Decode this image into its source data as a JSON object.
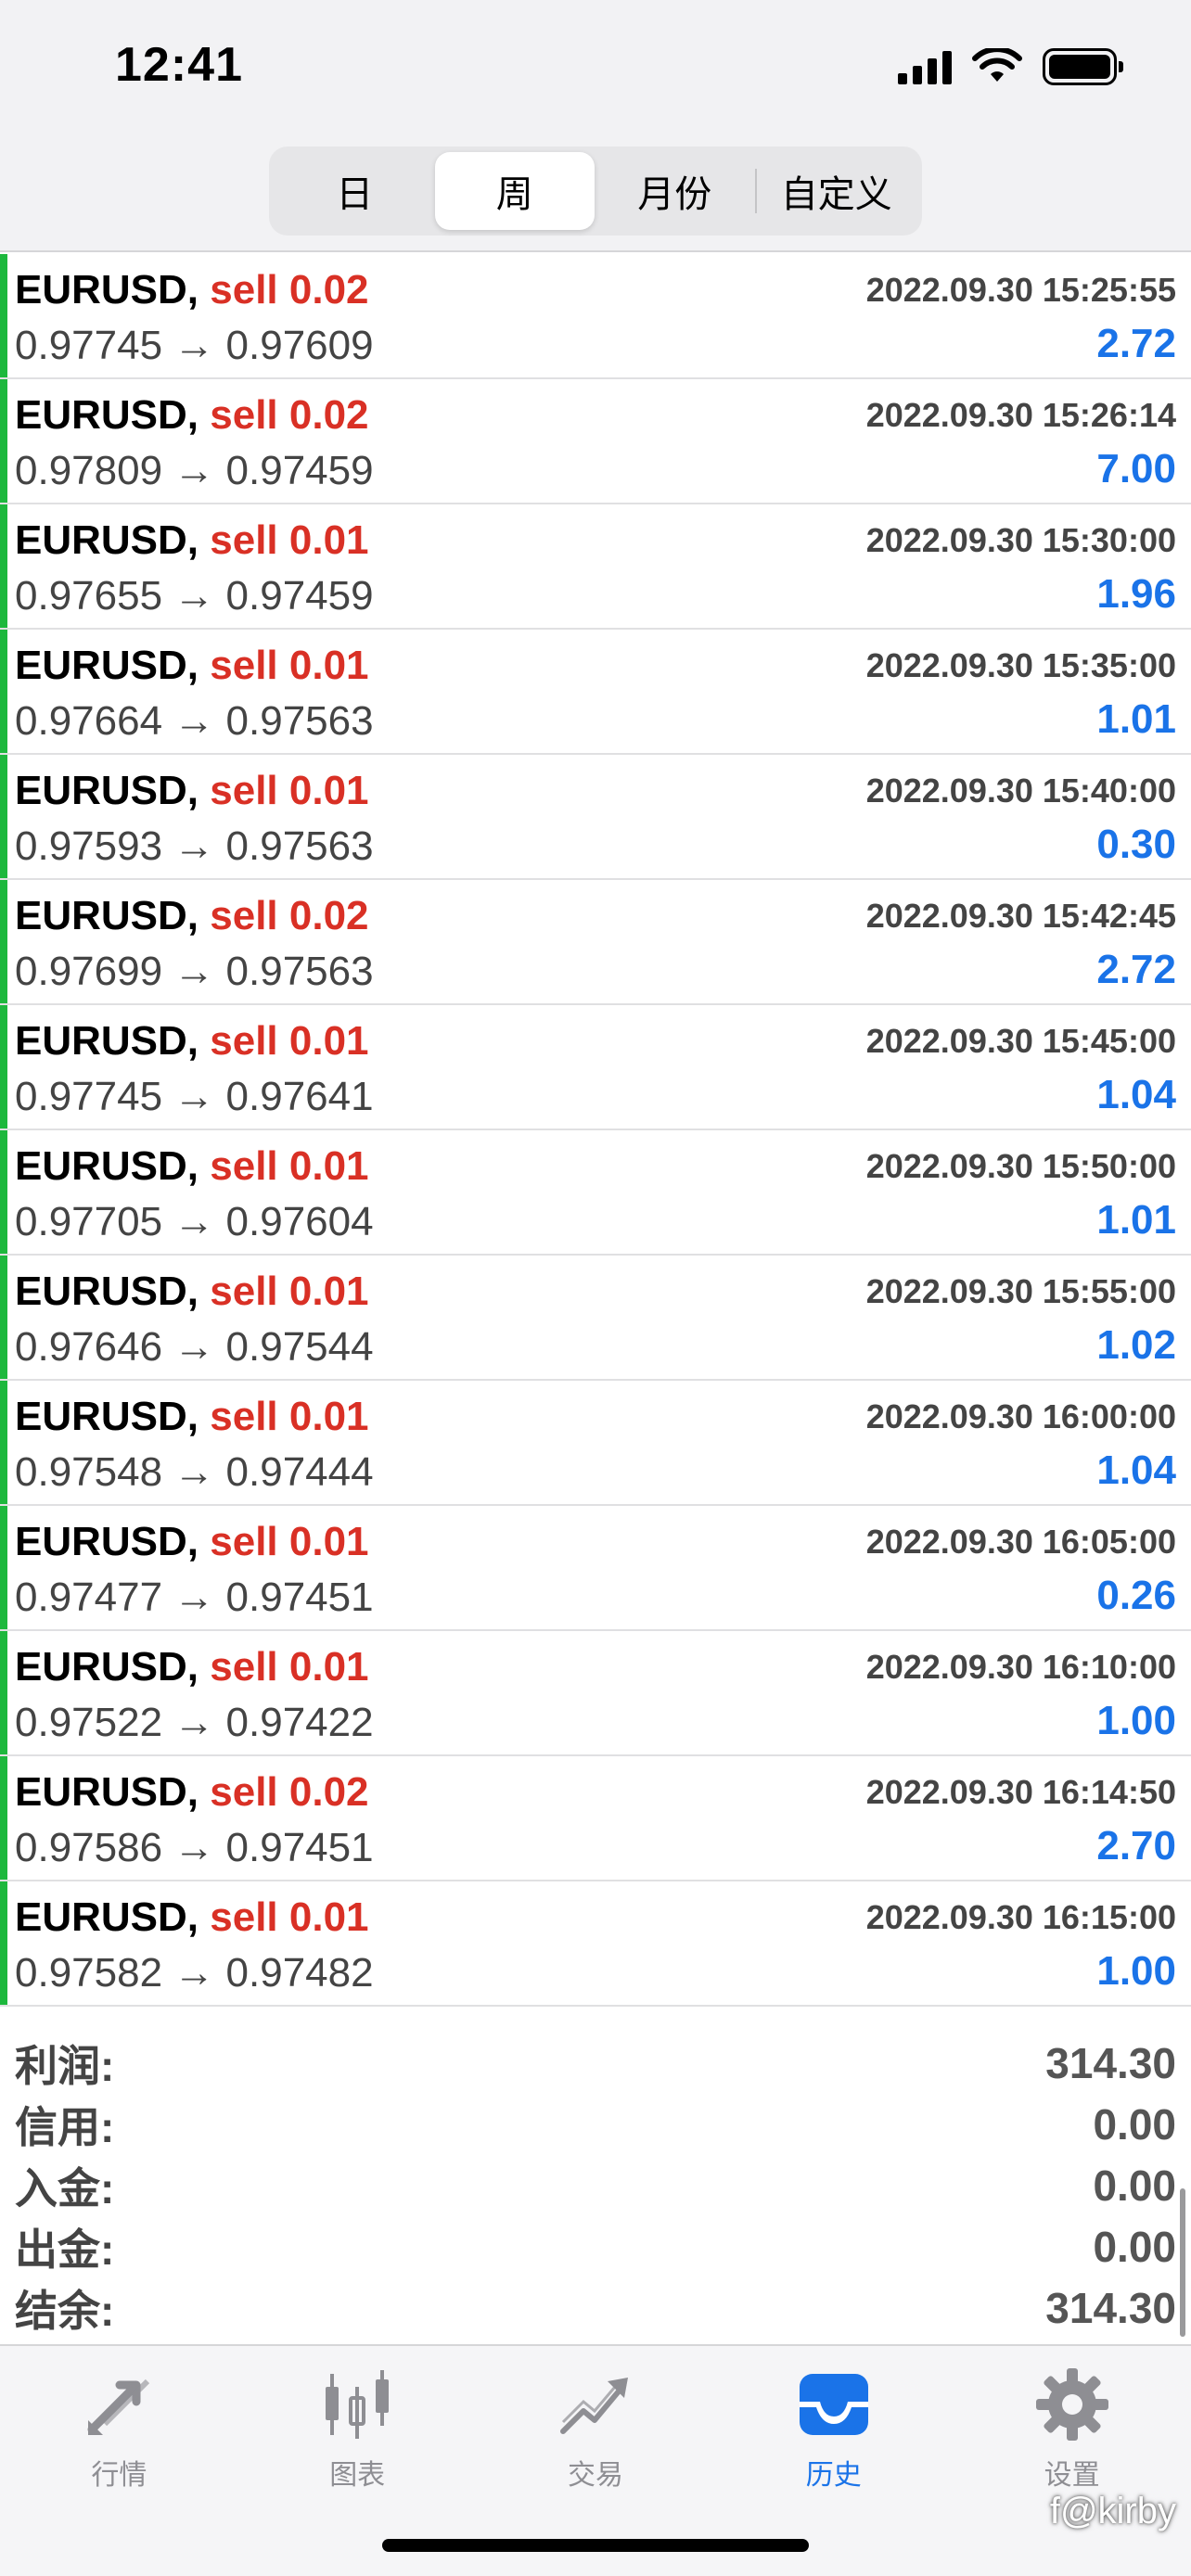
{
  "status": {
    "time": "12:41"
  },
  "period_tabs": [
    {
      "label": "日",
      "active": false
    },
    {
      "label": "周",
      "active": true
    },
    {
      "label": "月份",
      "active": false
    },
    {
      "label": "自定义",
      "active": false
    }
  ],
  "deals": [
    {
      "symbol": "EURUSD,",
      "side": "sell 0.02",
      "time": "2022.09.30 15:25:55",
      "open": "0.97745",
      "arrow": "→",
      "close": "0.97609",
      "profit": "2.72"
    },
    {
      "symbol": "EURUSD,",
      "side": "sell 0.02",
      "time": "2022.09.30 15:26:14",
      "open": "0.97809",
      "arrow": "→",
      "close": "0.97459",
      "profit": "7.00"
    },
    {
      "symbol": "EURUSD,",
      "side": "sell 0.01",
      "time": "2022.09.30 15:30:00",
      "open": "0.97655",
      "arrow": "→",
      "close": "0.97459",
      "profit": "1.96"
    },
    {
      "symbol": "EURUSD,",
      "side": "sell 0.01",
      "time": "2022.09.30 15:35:00",
      "open": "0.97664",
      "arrow": "→",
      "close": "0.97563",
      "profit": "1.01"
    },
    {
      "symbol": "EURUSD,",
      "side": "sell 0.01",
      "time": "2022.09.30 15:40:00",
      "open": "0.97593",
      "arrow": "→",
      "close": "0.97563",
      "profit": "0.30"
    },
    {
      "symbol": "EURUSD,",
      "side": "sell 0.02",
      "time": "2022.09.30 15:42:45",
      "open": "0.97699",
      "arrow": "→",
      "close": "0.97563",
      "profit": "2.72"
    },
    {
      "symbol": "EURUSD,",
      "side": "sell 0.01",
      "time": "2022.09.30 15:45:00",
      "open": "0.97745",
      "arrow": "→",
      "close": "0.97641",
      "profit": "1.04"
    },
    {
      "symbol": "EURUSD,",
      "side": "sell 0.01",
      "time": "2022.09.30 15:50:00",
      "open": "0.97705",
      "arrow": "→",
      "close": "0.97604",
      "profit": "1.01"
    },
    {
      "symbol": "EURUSD,",
      "side": "sell 0.01",
      "time": "2022.09.30 15:55:00",
      "open": "0.97646",
      "arrow": "→",
      "close": "0.97544",
      "profit": "1.02"
    },
    {
      "symbol": "EURUSD,",
      "side": "sell 0.01",
      "time": "2022.09.30 16:00:00",
      "open": "0.97548",
      "arrow": "→",
      "close": "0.97444",
      "profit": "1.04"
    },
    {
      "symbol": "EURUSD,",
      "side": "sell 0.01",
      "time": "2022.09.30 16:05:00",
      "open": "0.97477",
      "arrow": "→",
      "close": "0.97451",
      "profit": "0.26"
    },
    {
      "symbol": "EURUSD,",
      "side": "sell 0.01",
      "time": "2022.09.30 16:10:00",
      "open": "0.97522",
      "arrow": "→",
      "close": "0.97422",
      "profit": "1.00"
    },
    {
      "symbol": "EURUSD,",
      "side": "sell 0.02",
      "time": "2022.09.30 16:14:50",
      "open": "0.97586",
      "arrow": "→",
      "close": "0.97451",
      "profit": "2.70"
    },
    {
      "symbol": "EURUSD,",
      "side": "sell 0.01",
      "time": "2022.09.30 16:15:00",
      "open": "0.97582",
      "arrow": "→",
      "close": "0.97482",
      "profit": "1.00"
    }
  ],
  "summary": [
    {
      "label": "利润:",
      "value": "314.30"
    },
    {
      "label": "信用:",
      "value": "0.00"
    },
    {
      "label": "入金:",
      "value": "0.00"
    },
    {
      "label": "出金:",
      "value": "0.00"
    },
    {
      "label": "结余:",
      "value": "314.30"
    }
  ],
  "tabbar": [
    {
      "label": "行情",
      "icon": "quotes-arrows-icon",
      "active": false
    },
    {
      "label": "图表",
      "icon": "candlestick-chart-icon",
      "active": false
    },
    {
      "label": "交易",
      "icon": "trade-chart-icon",
      "active": false
    },
    {
      "label": "历史",
      "icon": "history-inbox-icon",
      "active": true
    },
    {
      "label": "设置",
      "icon": "gear-icon",
      "active": false
    }
  ],
  "watermark": "f@kirby",
  "colors": {
    "buy_marker": "#1db83d",
    "sell": "#d93025",
    "profit": "#1a73e8",
    "tab_active": "#1a73e8",
    "tab_inactive": "#8e8e93"
  }
}
